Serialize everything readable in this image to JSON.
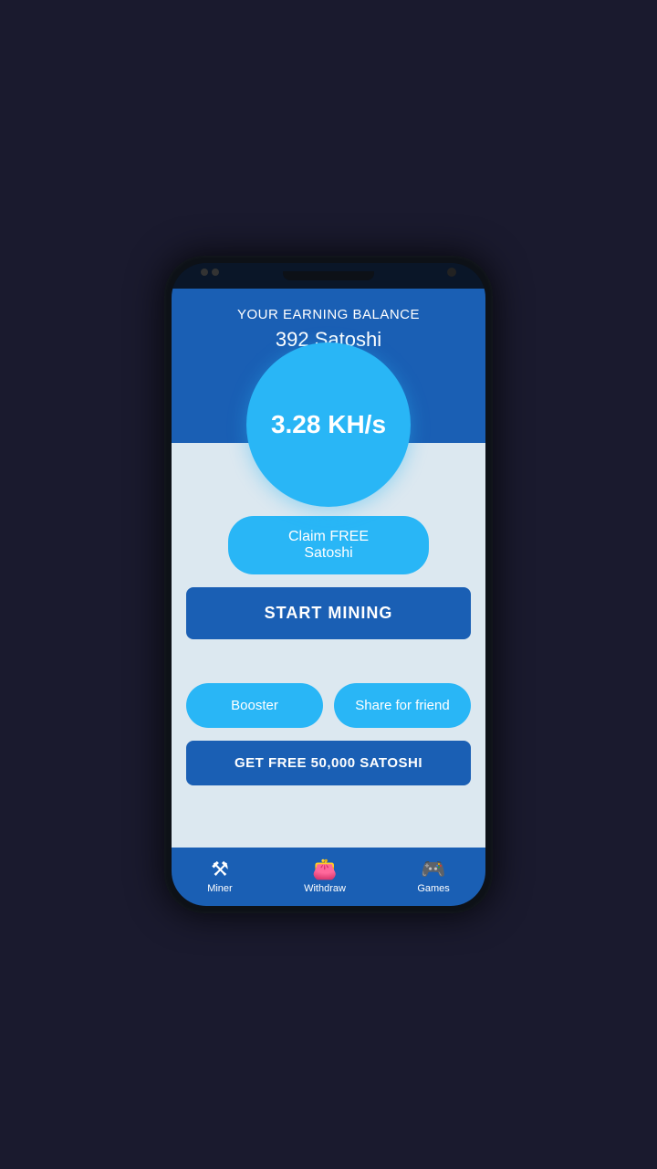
{
  "statusBar": {
    "notchWidth": 100
  },
  "topSection": {
    "balanceLabel": "YOUR EARNING BALANCE",
    "balanceValue": "392 Satoshi",
    "miningSpeed": "3.28 KH/s"
  },
  "buttons": {
    "claim": "Claim FREE Satoshi",
    "startMining": "START MINING",
    "booster": "Booster",
    "share": "Share for friend",
    "getFree": "GET FREE 50,000 SATOSHI"
  },
  "bottomNav": [
    {
      "id": "miner",
      "label": "Miner",
      "icon": "⚒"
    },
    {
      "id": "withdraw",
      "label": "Withdraw",
      "icon": "👛"
    },
    {
      "id": "games",
      "label": "Games",
      "icon": "🎮"
    }
  ]
}
